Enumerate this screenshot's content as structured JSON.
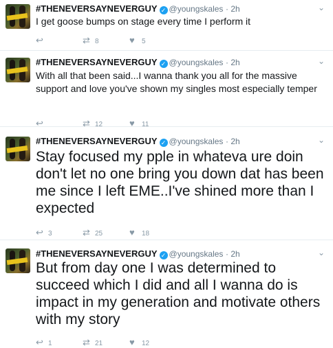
{
  "tweets": [
    {
      "name": "#THENEVERSAYNEVERGUY",
      "handle": "@youngskales",
      "time": "· 2h",
      "text": "I get goose bumps on stage every time I perform it",
      "replies": "",
      "retweets": "8",
      "likes": "5"
    },
    {
      "name": "#THENEVERSAYNEVERGUY",
      "handle": "@youngskales",
      "time": "· 2h",
      "text": "With all that been said...I wanna thank you all for the massive support and love you've shown my singles most especially temper",
      "replies": "",
      "retweets": "12",
      "likes": "11"
    },
    {
      "name": "#THENEVERSAYNEVERGUY",
      "handle": "@youngskales",
      "time": "· 2h",
      "text": "Stay focused my pple in whateva ure doin don't let no one bring you down dat has been me since I left EME..I've shined more than I expected",
      "replies": "3",
      "retweets": "25",
      "likes": "18"
    },
    {
      "name": "#THENEVERSAYNEVERGUY",
      "handle": "@youngskales",
      "time": "· 2h",
      "text": "But from day one I was determined to succeed which I did and all I wanna do is impact in my generation and motivate others with my story",
      "replies": "1",
      "retweets": "21",
      "likes": "12"
    }
  ],
  "icons": {
    "reply": "reply-icon",
    "retweet": "retweet-icon",
    "like": "heart-icon",
    "more": "chevron-down-icon",
    "verified": "verified-badge-icon"
  },
  "colors": {
    "verified": "#1da1f2",
    "muted": "#8899a6",
    "text": "#14171a"
  }
}
